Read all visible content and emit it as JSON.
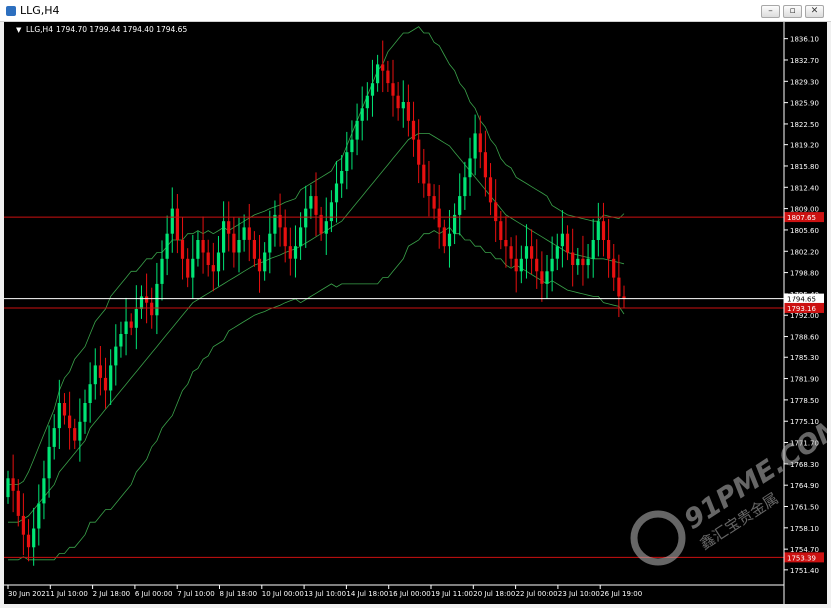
{
  "window": {
    "title": "LLG,H4",
    "buttons": {
      "minimize": "–",
      "restore": "▫",
      "close": "✕"
    }
  },
  "chart_header": {
    "symbol": "LLG,H4",
    "ohlc": "1794.70 1799.44 1794.40 1794.65"
  },
  "watermark": {
    "text": "91PME.COM",
    "subtext": "鑫汇宝贵金属"
  },
  "colors": {
    "background": "#000000",
    "bull": "#00e676",
    "bear": "#e81010",
    "bands": "#3aa24a",
    "hline": "#cc1111",
    "axis": "#ffffff"
  },
  "chart_data": {
    "type": "candlestick",
    "title": "",
    "xlabel": "",
    "ylabel": "",
    "grid": false,
    "ylim": [
      1750.1,
      1837.8
    ],
    "y_ticks": [
      1836.1,
      1832.7,
      1829.3,
      1825.9,
      1822.5,
      1819.2,
      1815.8,
      1812.4,
      1809.0,
      1805.6,
      1802.2,
      1798.8,
      1795.4,
      1792.0,
      1788.6,
      1785.3,
      1781.9,
      1778.5,
      1775.1,
      1771.7,
      1768.3,
      1764.9,
      1761.5,
      1758.1,
      1754.7,
      1751.4
    ],
    "x_ticks": [
      "30 Jun 2021",
      "1 Jul 10:00",
      "2 Jul 18:00",
      "6 Jul 00:00",
      "7 Jul 10:00",
      "8 Jul 18:00",
      "10 Jul 00:00",
      "13 Jul 10:00",
      "14 Jul 18:00",
      "16 Jul 00:00",
      "19 Jul 11:00",
      "20 Jul 18:00",
      "22 Jul 00:00",
      "23 Jul 10:00",
      "26 Jul 19:00"
    ],
    "horizontal_lines": [
      {
        "price": 1807.65,
        "label": "1807.65",
        "color": "#cc1111"
      },
      {
        "price": 1794.65,
        "label": "1794.65",
        "color": "#ffffff",
        "current": true
      },
      {
        "price": 1793.16,
        "label": "1793.16",
        "color": "#cc1111"
      },
      {
        "price": 1753.39,
        "label": "1753.39",
        "color": "#cc1111"
      }
    ],
    "close": [
      1766,
      1764,
      1760,
      1757,
      1755,
      1758,
      1762,
      1766,
      1771,
      1774,
      1778,
      1776,
      1774,
      1772,
      1775,
      1778,
      1781,
      1784,
      1782,
      1780,
      1784,
      1787,
      1789,
      1791,
      1790,
      1793,
      1795,
      1794,
      1792,
      1797,
      1801,
      1805,
      1809,
      1804,
      1801,
      1798,
      1801,
      1804,
      1802,
      1800,
      1799,
      1802,
      1807,
      1805,
      1802,
      1804,
      1806,
      1804,
      1801,
      1799,
      1802,
      1805,
      1808,
      1806,
      1803,
      1801,
      1803,
      1806,
      1809,
      1811,
      1808,
      1805,
      1807,
      1810,
      1813,
      1815,
      1818,
      1820,
      1823,
      1825,
      1827,
      1829,
      1832,
      1831,
      1829,
      1827,
      1825,
      1826,
      1823,
      1820,
      1816,
      1813,
      1811,
      1809,
      1806,
      1803,
      1805,
      1808,
      1811,
      1814,
      1817,
      1821,
      1818,
      1814,
      1810,
      1807,
      1804,
      1803,
      1801,
      1799,
      1801,
      1803,
      1801,
      1799,
      1797,
      1799,
      1801,
      1803,
      1805,
      1802,
      1800,
      1801,
      1800,
      1801,
      1804,
      1807,
      1804,
      1801,
      1798,
      1795,
      1794.65
    ],
    "ma_middle": [
      1759,
      1759,
      1759,
      1759.5,
      1760,
      1761,
      1762,
      1763,
      1764,
      1765,
      1767,
      1768,
      1769,
      1770,
      1771,
      1772,
      1774,
      1775,
      1776,
      1777,
      1778,
      1779,
      1780,
      1781,
      1782,
      1783,
      1784,
      1785,
      1786,
      1787,
      1788,
      1789,
      1790,
      1791,
      1792,
      1793,
      1794,
      1794.5,
      1795,
      1795.5,
      1796,
      1796.5,
      1797,
      1797.5,
      1798,
      1798.5,
      1799,
      1799.5,
      1800,
      1800.3,
      1800.6,
      1801,
      1801.3,
      1801.6,
      1802,
      1802.3,
      1802.6,
      1803,
      1803.5,
      1804,
      1804.5,
      1805,
      1805.5,
      1806,
      1806.5,
      1807,
      1808,
      1809,
      1810,
      1811,
      1812,
      1813,
      1814,
      1815,
      1816,
      1817,
      1818,
      1819,
      1820,
      1820.5,
      1821,
      1821,
      1821,
      1820.5,
      1820,
      1819.5,
      1819,
      1818,
      1817,
      1816,
      1815,
      1814,
      1813,
      1812,
      1811,
      1810,
      1809,
      1808,
      1807.5,
      1807,
      1806.5,
      1806,
      1805.5,
      1805,
      1804.5,
      1804,
      1803.5,
      1803,
      1802.5,
      1802,
      1801.8,
      1801.6,
      1801.4,
      1801.2,
      1801,
      1801,
      1801,
      1800.8,
      1800.6,
      1800.4,
      1800.2
    ],
    "band_width": [
      6,
      6,
      6,
      6,
      7,
      8,
      9,
      10,
      11,
      12,
      13,
      14,
      14,
      15,
      15,
      15,
      15,
      16,
      16,
      16,
      17,
      17,
      17,
      17,
      17,
      16,
      16,
      16,
      15,
      15,
      14,
      14,
      14,
      13,
      12,
      12,
      11,
      11,
      10,
      10,
      9,
      9,
      9,
      8,
      8,
      8,
      8,
      8,
      8,
      8,
      8,
      8,
      8,
      8,
      8,
      8,
      8,
      9,
      9,
      9,
      9,
      9,
      9,
      9,
      10,
      10,
      11,
      12,
      13,
      14,
      15,
      16,
      17,
      17,
      18,
      18,
      18,
      18,
      17,
      17,
      17,
      16,
      16,
      15,
      15,
      14,
      13,
      13,
      12,
      12,
      11,
      11,
      10,
      10,
      9,
      9,
      8,
      8,
      8,
      7,
      7,
      7,
      7,
      7,
      7,
      7,
      6,
      6,
      6,
      6,
      6,
      6,
      6,
      6,
      6,
      6,
      7,
      7,
      7,
      7
    ]
  }
}
